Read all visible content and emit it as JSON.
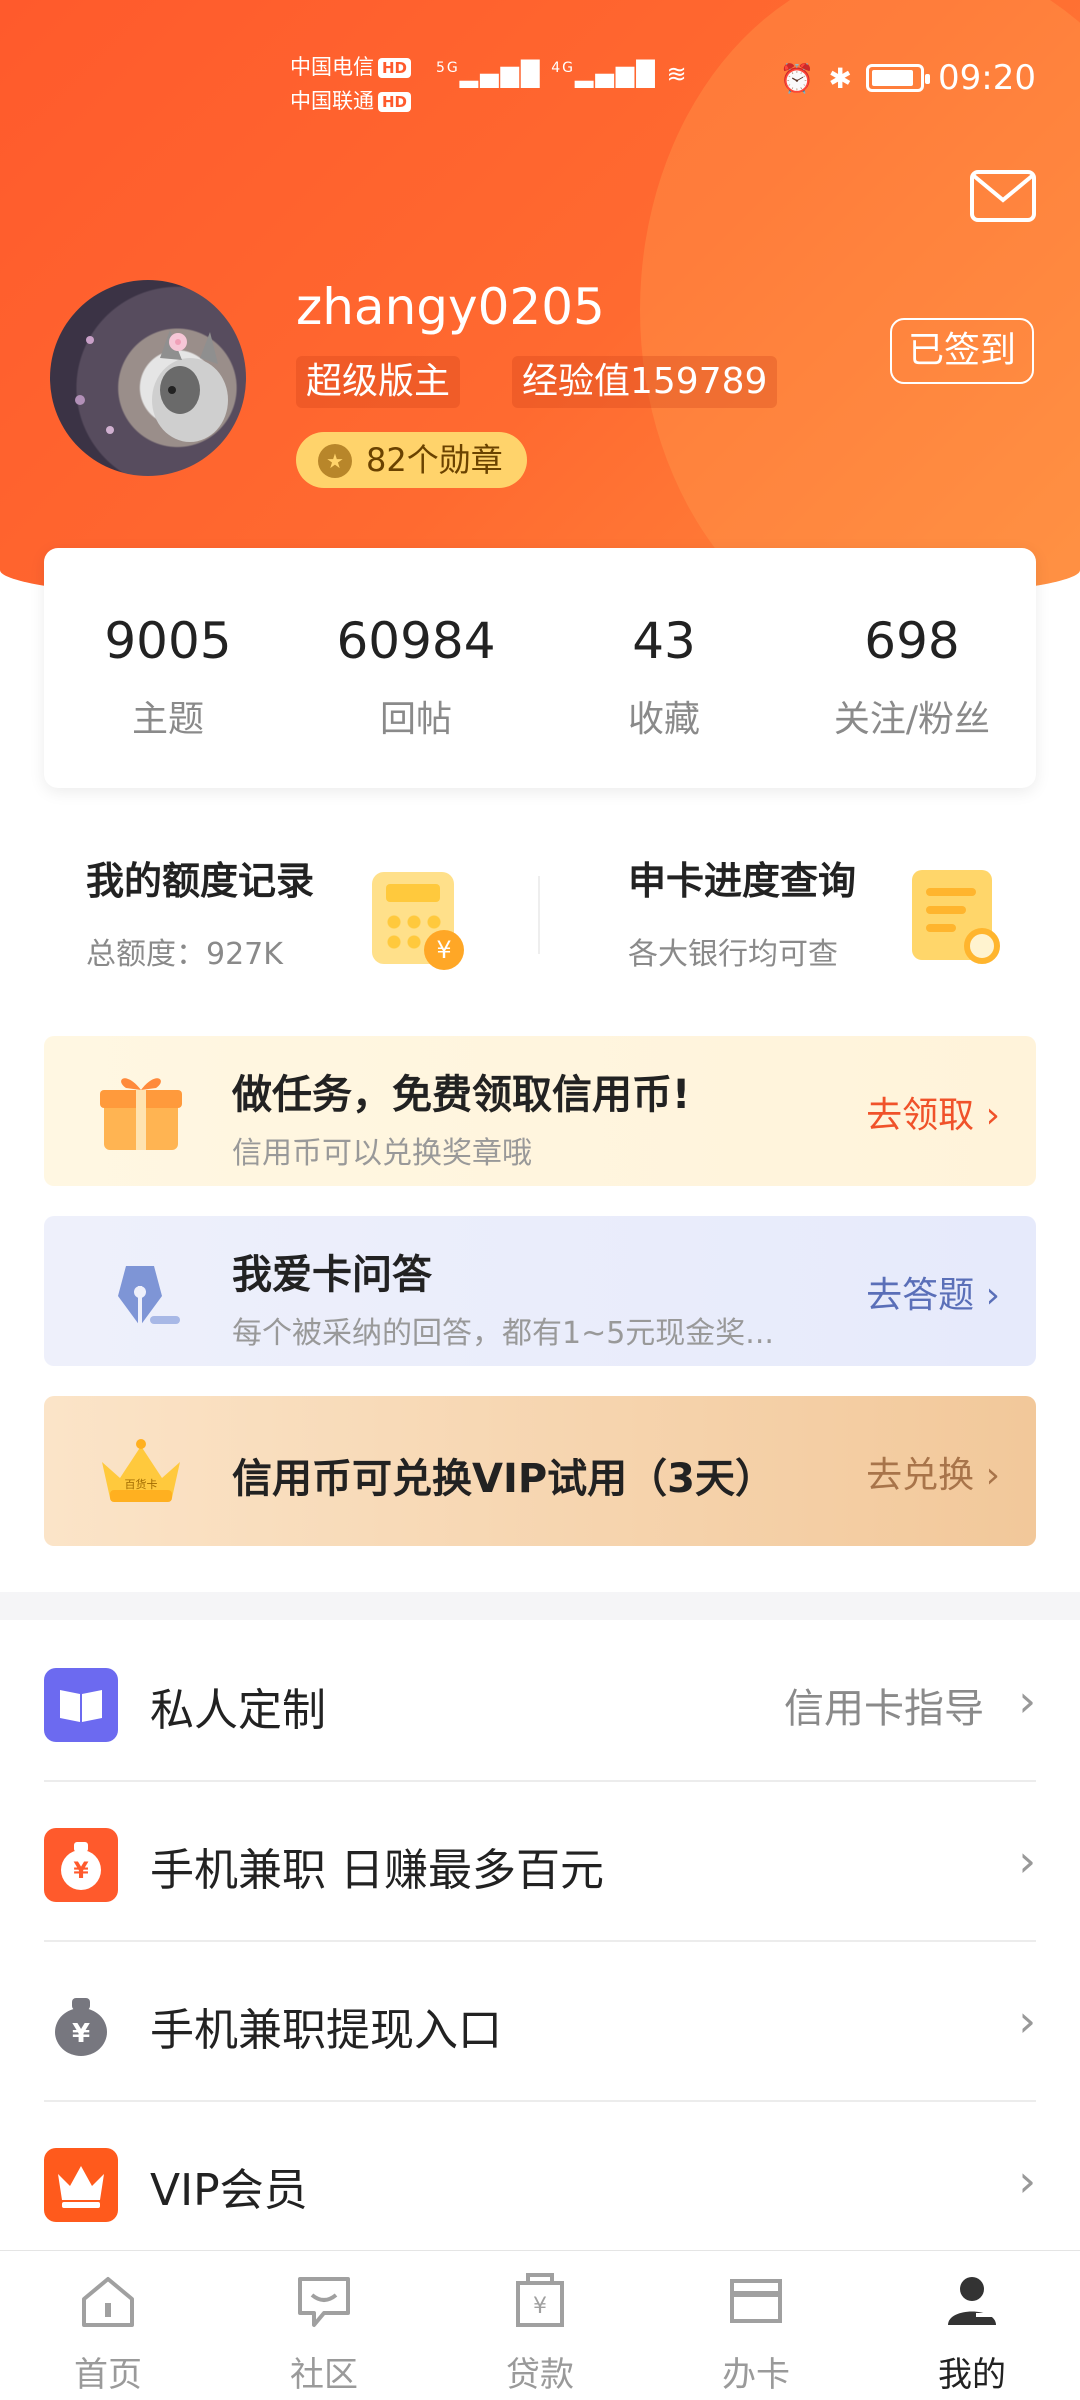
{
  "status_bar": {
    "carrier1": "中国电信",
    "carrier2": "中国联通",
    "hd": "HD",
    "net1": "5G",
    "net2": "4G",
    "time": "09:20"
  },
  "profile": {
    "username": "zhangy0205",
    "role": "超级版主",
    "exp": "经验值159789",
    "medals": "82个勋章",
    "signed_label": "已签到"
  },
  "stats": [
    {
      "value": "9005",
      "label": "主题"
    },
    {
      "value": "60984",
      "label": "回帖"
    },
    {
      "value": "43",
      "label": "收藏"
    },
    {
      "value": "698",
      "label": "关注/粉丝"
    }
  ],
  "quick": {
    "credit_title": "我的额度记录",
    "credit_sub": "总额度：927K",
    "progress_title": "申卡进度查询",
    "progress_sub": "各大银行均可查"
  },
  "banners": {
    "task_title": "做任务，免费领取信用币!",
    "task_sub": "信用币可以兑换奖章哦",
    "task_action": "去领取 ›",
    "qa_title": "我爱卡问答",
    "qa_sub": "每个被采纳的回答，都有1~5元现金奖...",
    "qa_action": "去答题 ›",
    "vip_title": "信用币可兑换VIP试用（3天）",
    "vip_action": "去兑换 ›",
    "crown_text": "百货卡"
  },
  "list": [
    {
      "title": "私人定制",
      "right": "信用卡指导"
    },
    {
      "title": "手机兼职 日赚最多百元",
      "right": ""
    },
    {
      "title": "手机兼职提现入口",
      "right": ""
    },
    {
      "title": "VIP会员",
      "right": ""
    }
  ],
  "nav": [
    {
      "label": "首页"
    },
    {
      "label": "社区"
    },
    {
      "label": "贷款"
    },
    {
      "label": "办卡"
    },
    {
      "label": "我的"
    }
  ],
  "colors": {
    "header_orange": "#ff5a2c",
    "action_orange": "#f0522a",
    "action_blue": "#5a6fb8",
    "action_brown": "#a8744a"
  }
}
